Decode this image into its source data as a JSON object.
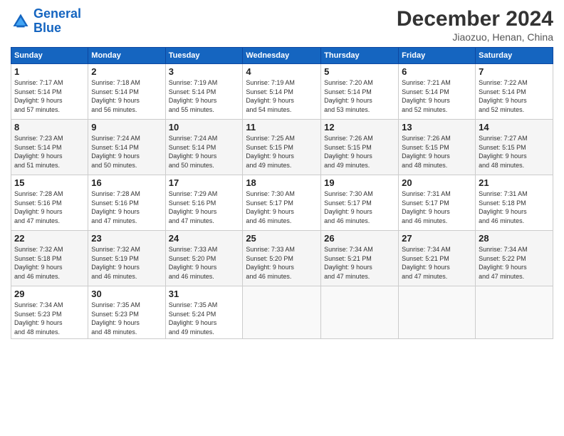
{
  "header": {
    "logo_line1": "General",
    "logo_line2": "Blue",
    "month": "December 2024",
    "location": "Jiaozuo, Henan, China"
  },
  "weekdays": [
    "Sunday",
    "Monday",
    "Tuesday",
    "Wednesday",
    "Thursday",
    "Friday",
    "Saturday"
  ],
  "weeks": [
    [
      {
        "day": "1",
        "info": "Sunrise: 7:17 AM\nSunset: 5:14 PM\nDaylight: 9 hours\nand 57 minutes."
      },
      {
        "day": "2",
        "info": "Sunrise: 7:18 AM\nSunset: 5:14 PM\nDaylight: 9 hours\nand 56 minutes."
      },
      {
        "day": "3",
        "info": "Sunrise: 7:19 AM\nSunset: 5:14 PM\nDaylight: 9 hours\nand 55 minutes."
      },
      {
        "day": "4",
        "info": "Sunrise: 7:19 AM\nSunset: 5:14 PM\nDaylight: 9 hours\nand 54 minutes."
      },
      {
        "day": "5",
        "info": "Sunrise: 7:20 AM\nSunset: 5:14 PM\nDaylight: 9 hours\nand 53 minutes."
      },
      {
        "day": "6",
        "info": "Sunrise: 7:21 AM\nSunset: 5:14 PM\nDaylight: 9 hours\nand 52 minutes."
      },
      {
        "day": "7",
        "info": "Sunrise: 7:22 AM\nSunset: 5:14 PM\nDaylight: 9 hours\nand 52 minutes."
      }
    ],
    [
      {
        "day": "8",
        "info": "Sunrise: 7:23 AM\nSunset: 5:14 PM\nDaylight: 9 hours\nand 51 minutes."
      },
      {
        "day": "9",
        "info": "Sunrise: 7:24 AM\nSunset: 5:14 PM\nDaylight: 9 hours\nand 50 minutes."
      },
      {
        "day": "10",
        "info": "Sunrise: 7:24 AM\nSunset: 5:14 PM\nDaylight: 9 hours\nand 50 minutes."
      },
      {
        "day": "11",
        "info": "Sunrise: 7:25 AM\nSunset: 5:15 PM\nDaylight: 9 hours\nand 49 minutes."
      },
      {
        "day": "12",
        "info": "Sunrise: 7:26 AM\nSunset: 5:15 PM\nDaylight: 9 hours\nand 49 minutes."
      },
      {
        "day": "13",
        "info": "Sunrise: 7:26 AM\nSunset: 5:15 PM\nDaylight: 9 hours\nand 48 minutes."
      },
      {
        "day": "14",
        "info": "Sunrise: 7:27 AM\nSunset: 5:15 PM\nDaylight: 9 hours\nand 48 minutes."
      }
    ],
    [
      {
        "day": "15",
        "info": "Sunrise: 7:28 AM\nSunset: 5:16 PM\nDaylight: 9 hours\nand 47 minutes."
      },
      {
        "day": "16",
        "info": "Sunrise: 7:28 AM\nSunset: 5:16 PM\nDaylight: 9 hours\nand 47 minutes."
      },
      {
        "day": "17",
        "info": "Sunrise: 7:29 AM\nSunset: 5:16 PM\nDaylight: 9 hours\nand 47 minutes."
      },
      {
        "day": "18",
        "info": "Sunrise: 7:30 AM\nSunset: 5:17 PM\nDaylight: 9 hours\nand 46 minutes."
      },
      {
        "day": "19",
        "info": "Sunrise: 7:30 AM\nSunset: 5:17 PM\nDaylight: 9 hours\nand 46 minutes."
      },
      {
        "day": "20",
        "info": "Sunrise: 7:31 AM\nSunset: 5:17 PM\nDaylight: 9 hours\nand 46 minutes."
      },
      {
        "day": "21",
        "info": "Sunrise: 7:31 AM\nSunset: 5:18 PM\nDaylight: 9 hours\nand 46 minutes."
      }
    ],
    [
      {
        "day": "22",
        "info": "Sunrise: 7:32 AM\nSunset: 5:18 PM\nDaylight: 9 hours\nand 46 minutes."
      },
      {
        "day": "23",
        "info": "Sunrise: 7:32 AM\nSunset: 5:19 PM\nDaylight: 9 hours\nand 46 minutes."
      },
      {
        "day": "24",
        "info": "Sunrise: 7:33 AM\nSunset: 5:20 PM\nDaylight: 9 hours\nand 46 minutes."
      },
      {
        "day": "25",
        "info": "Sunrise: 7:33 AM\nSunset: 5:20 PM\nDaylight: 9 hours\nand 46 minutes."
      },
      {
        "day": "26",
        "info": "Sunrise: 7:34 AM\nSunset: 5:21 PM\nDaylight: 9 hours\nand 47 minutes."
      },
      {
        "day": "27",
        "info": "Sunrise: 7:34 AM\nSunset: 5:21 PM\nDaylight: 9 hours\nand 47 minutes."
      },
      {
        "day": "28",
        "info": "Sunrise: 7:34 AM\nSunset: 5:22 PM\nDaylight: 9 hours\nand 47 minutes."
      }
    ],
    [
      {
        "day": "29",
        "info": "Sunrise: 7:34 AM\nSunset: 5:23 PM\nDaylight: 9 hours\nand 48 minutes."
      },
      {
        "day": "30",
        "info": "Sunrise: 7:35 AM\nSunset: 5:23 PM\nDaylight: 9 hours\nand 48 minutes."
      },
      {
        "day": "31",
        "info": "Sunrise: 7:35 AM\nSunset: 5:24 PM\nDaylight: 9 hours\nand 49 minutes."
      },
      {
        "day": "",
        "info": ""
      },
      {
        "day": "",
        "info": ""
      },
      {
        "day": "",
        "info": ""
      },
      {
        "day": "",
        "info": ""
      }
    ]
  ]
}
